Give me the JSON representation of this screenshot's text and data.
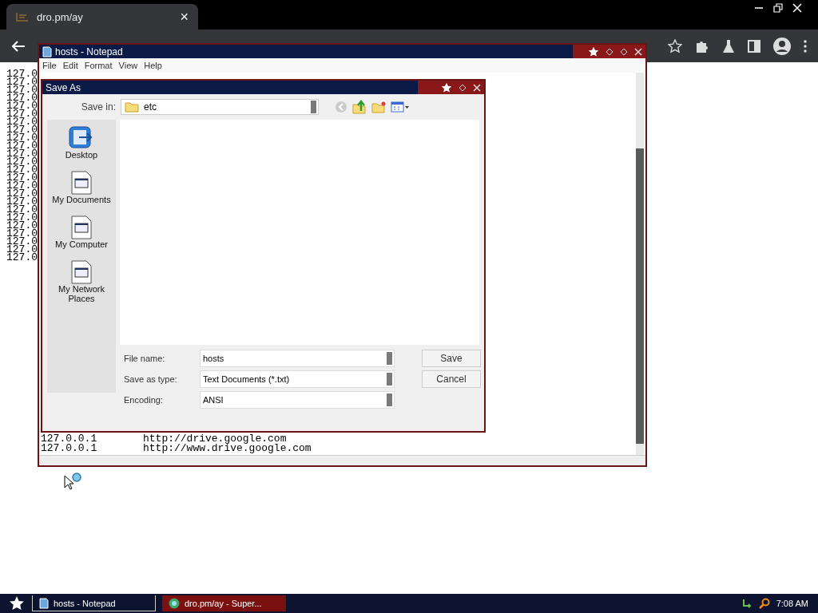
{
  "browser": {
    "tab": {
      "title": "dro.pm/ay",
      "close": "×"
    }
  },
  "page_lines": [
    "127.0",
    "127.0",
    "127.0",
    "127.0",
    "127.0",
    "127.0",
    "127.0",
    "127.0",
    "127.0",
    "127.0",
    "127.0",
    "127.0",
    "127.0",
    "127.0",
    "127.0",
    "127.0",
    "127.0",
    "127.0",
    "127.0",
    "127.0",
    "127.0",
    "127.0",
    "127.0",
    "127.0"
  ],
  "notepad": {
    "title": "hosts - Notepad",
    "menu": [
      "File",
      "Edit",
      "Format",
      "View",
      "Help"
    ],
    "lines": [
      {
        "ip": "127.0.0.1",
        "url": "http://drive.google.com"
      },
      {
        "ip": "127.0.0.1",
        "url": "http://www.drive.google.com"
      }
    ]
  },
  "save_as": {
    "title": "Save As",
    "save_in_label": "Save in:",
    "save_in_value": "etc",
    "places": [
      {
        "label": "Desktop",
        "kind": "desktop"
      },
      {
        "label": "My Documents",
        "kind": "document"
      },
      {
        "label": "My Computer",
        "kind": "document"
      },
      {
        "label": "My Network Places",
        "kind": "document"
      }
    ],
    "fields": [
      {
        "label": "File name:",
        "value": "hosts"
      },
      {
        "label": "Save as type:",
        "value": "Text Documents (*.txt)"
      },
      {
        "label": "Encoding:",
        "value": "ANSI"
      }
    ],
    "buttons": [
      "Save",
      "Cancel"
    ]
  },
  "taskbar": {
    "items": [
      {
        "label": "hosts - Notepad",
        "kind": "notepad",
        "selected": true
      },
      {
        "label": "dro.pm/ay - Super...",
        "kind": "browser",
        "selected": false
      }
    ],
    "clock": "7:08 AM"
  }
}
